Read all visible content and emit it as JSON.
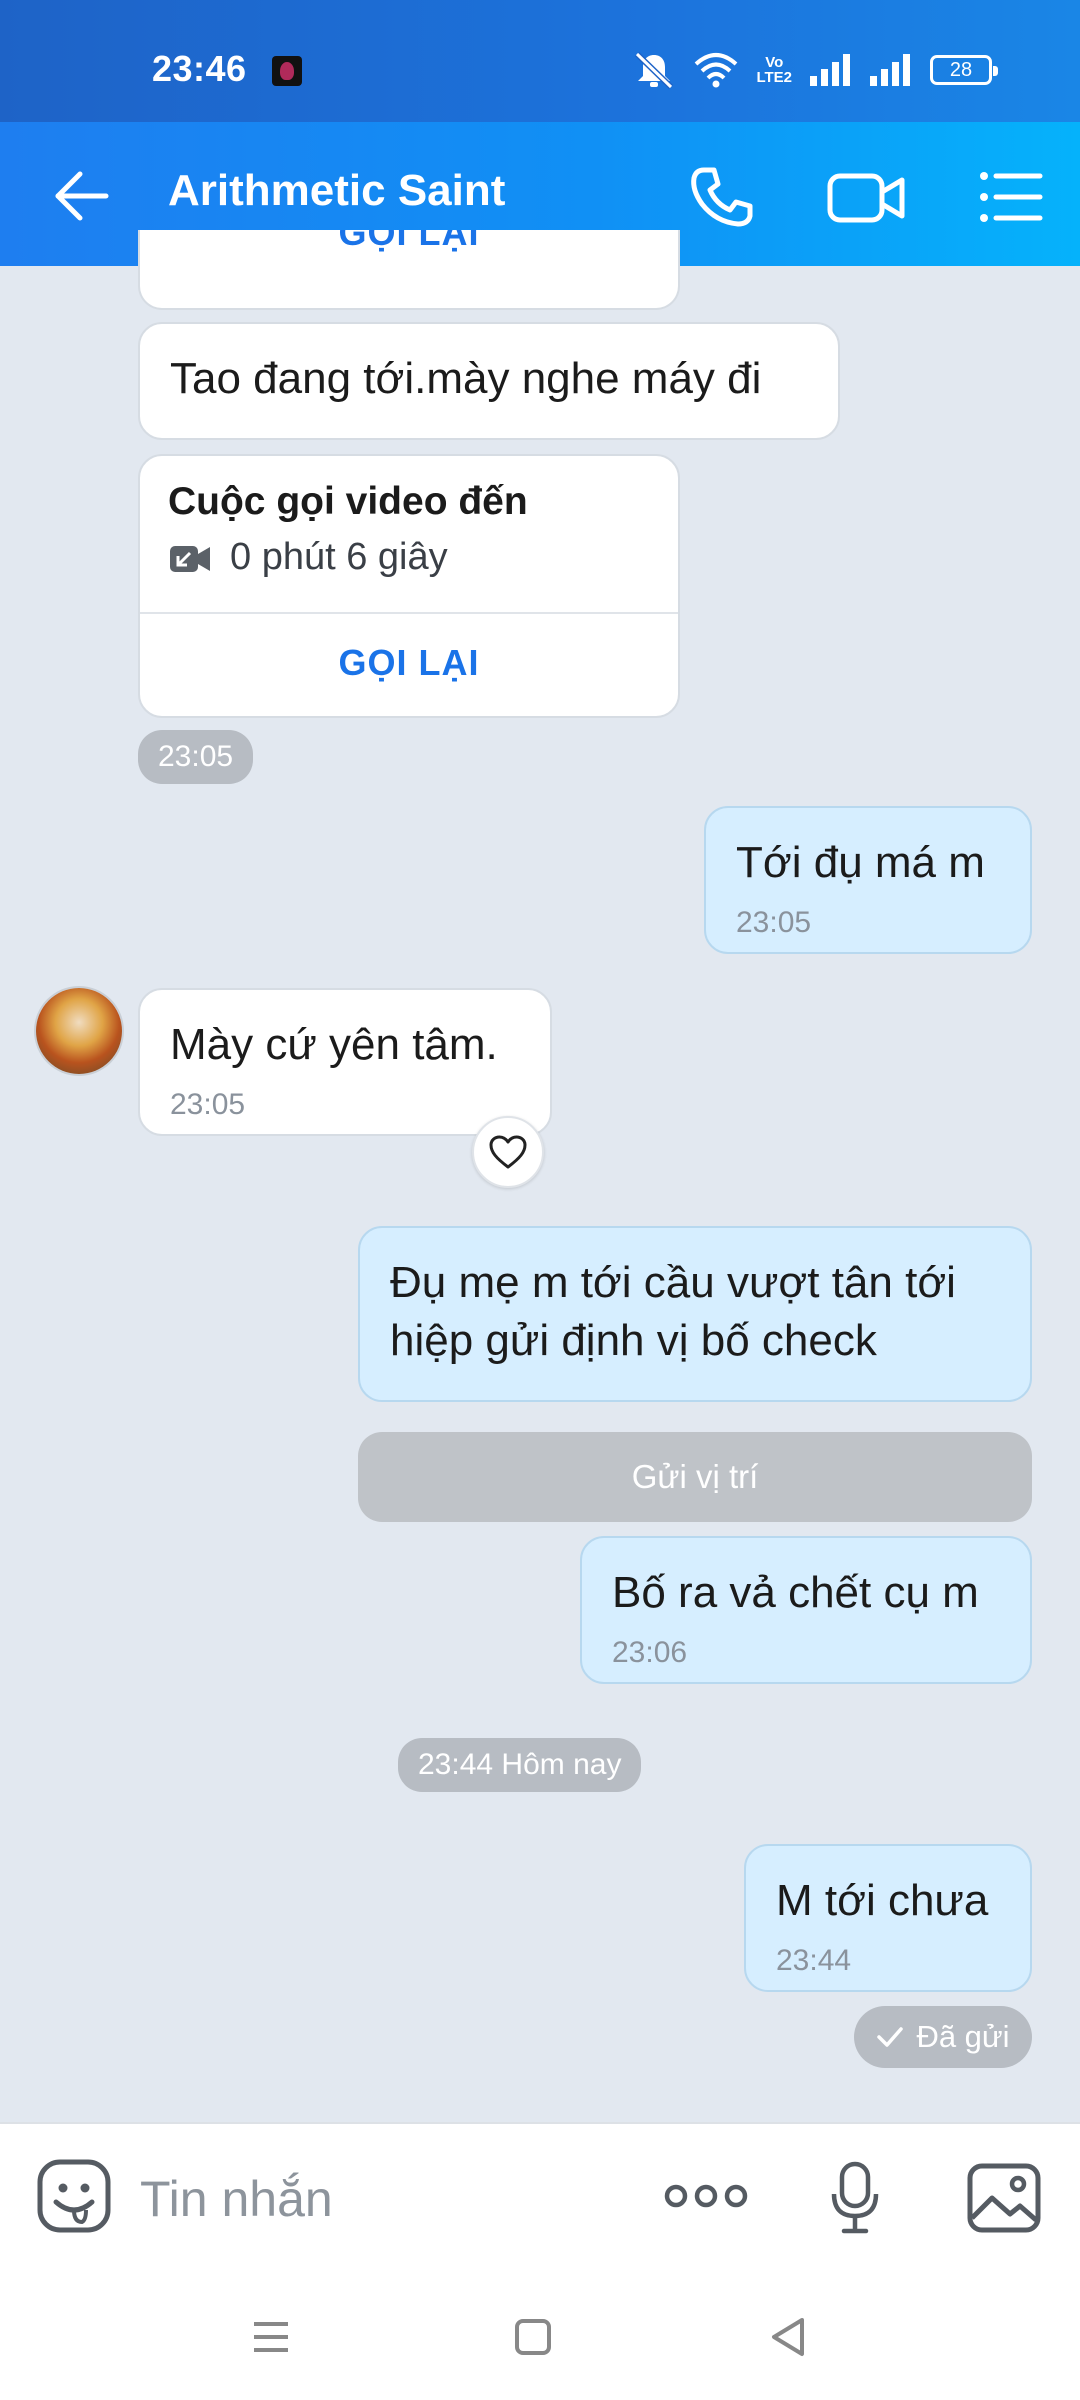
{
  "status_bar": {
    "time": "23:46",
    "battery": "28",
    "volte": "Vo\nLTE2"
  },
  "header": {
    "title": "Arithmetic Saint"
  },
  "messages": {
    "partial_recall": "GỌI LẠI",
    "m1": {
      "text": "Tao đang tới.mày nghe máy đi"
    },
    "call": {
      "title": "Cuộc gọi video đến",
      "duration": "0 phút 6 giây",
      "action": "GỌI LẠI",
      "time": "23:05"
    },
    "m2": {
      "text": "Tới đụ má m",
      "time": "23:05"
    },
    "m3": {
      "text": "Mày cứ yên tâm.",
      "time": "23:05"
    },
    "m4": {
      "text": "Đụ mẹ m tới cầu vượt tân tới hiệp gửi định vị bố check"
    },
    "location_button": "Gửi vị trí",
    "m5": {
      "text": "Bố ra vả chết cụ m",
      "time": "23:06"
    },
    "divider": "23:44 Hôm nay",
    "m6": {
      "text": "M tới chưa",
      "time": "23:44"
    },
    "sent_status": "Đã gửi"
  },
  "input": {
    "placeholder": "Tin nhắn"
  },
  "colors": {
    "header_start": "#1e7ef0",
    "header_end": "#05b2fb",
    "outgoing_bubble": "#d6eeff",
    "background": "#e2e8f0",
    "link": "#1a73e8"
  },
  "icons": [
    "back-arrow-icon",
    "phone-icon",
    "video-call-icon",
    "menu-list-icon",
    "video-call-incoming-icon",
    "heart-icon",
    "check-icon",
    "emoji-icon",
    "more-dots-icon",
    "mic-icon",
    "image-icon",
    "recent-apps-icon",
    "home-icon",
    "back-triangle-icon"
  ]
}
